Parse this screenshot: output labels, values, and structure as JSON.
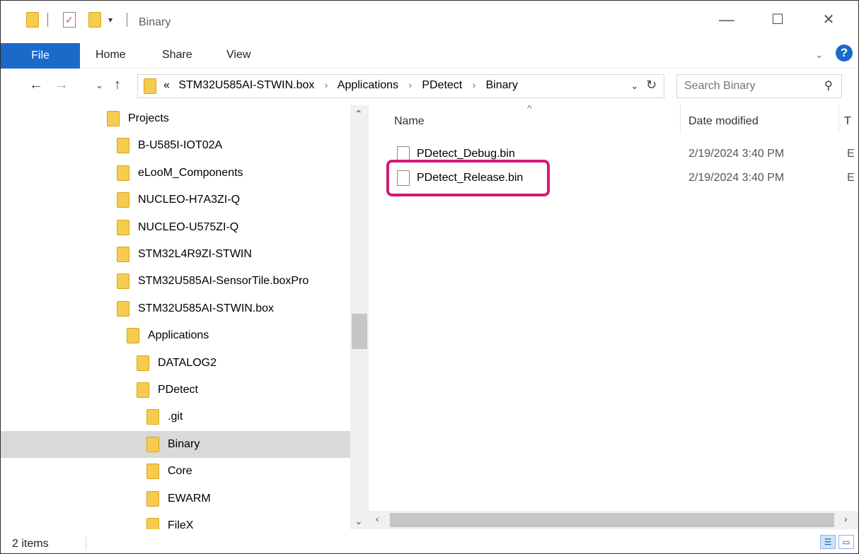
{
  "window": {
    "title": "Binary",
    "controls": {
      "minimize": "—",
      "maximize": "☐",
      "close": "✕"
    }
  },
  "ribbon": {
    "tabs": [
      "File",
      "Home",
      "Share",
      "View"
    ],
    "help": "?"
  },
  "address": {
    "overflow": "«",
    "crumbs": [
      "STM32U585AI-STWIN.box",
      "Applications",
      "PDetect",
      "Binary"
    ],
    "separator": "›",
    "search_placeholder": "Search Binary"
  },
  "nav_tree": [
    {
      "label": "Projects",
      "indent": 0,
      "selected": false
    },
    {
      "label": "B-U585I-IOT02A",
      "indent": 1,
      "selected": false
    },
    {
      "label": "eLooM_Components",
      "indent": 1,
      "selected": false
    },
    {
      "label": "NUCLEO-H7A3ZI-Q",
      "indent": 1,
      "selected": false
    },
    {
      "label": "NUCLEO-U575ZI-Q",
      "indent": 1,
      "selected": false
    },
    {
      "label": "STM32L4R9ZI-STWIN",
      "indent": 1,
      "selected": false
    },
    {
      "label": "STM32U585AI-SensorTile.boxPro",
      "indent": 1,
      "selected": false
    },
    {
      "label": "STM32U585AI-STWIN.box",
      "indent": 1,
      "selected": false
    },
    {
      "label": "Applications",
      "indent": 2,
      "selected": false
    },
    {
      "label": "DATALOG2",
      "indent": 3,
      "selected": false
    },
    {
      "label": "PDetect",
      "indent": 3,
      "selected": false
    },
    {
      "label": ".git",
      "indent": 4,
      "selected": false
    },
    {
      "label": "Binary",
      "indent": 4,
      "selected": true
    },
    {
      "label": "Core",
      "indent": 4,
      "selected": false
    },
    {
      "label": "EWARM",
      "indent": 4,
      "selected": false
    },
    {
      "label": "FileX",
      "indent": 4,
      "selected": false
    }
  ],
  "file_list": {
    "columns": {
      "name": "Name",
      "date": "Date modified",
      "type": "T"
    },
    "files": [
      {
        "name": "PDetect_Debug.bin",
        "date": "2/19/2024 3:40 PM",
        "type": "E"
      },
      {
        "name": "PDetect_Release.bin",
        "date": "2/19/2024 3:40 PM",
        "type": "E"
      }
    ]
  },
  "status": {
    "item_count": "2 items"
  },
  "colors": {
    "accent": "#1b6ac9",
    "highlight": "#d41a78",
    "folder": "#f7cb4d",
    "selected_row": "#d9d9d9"
  }
}
